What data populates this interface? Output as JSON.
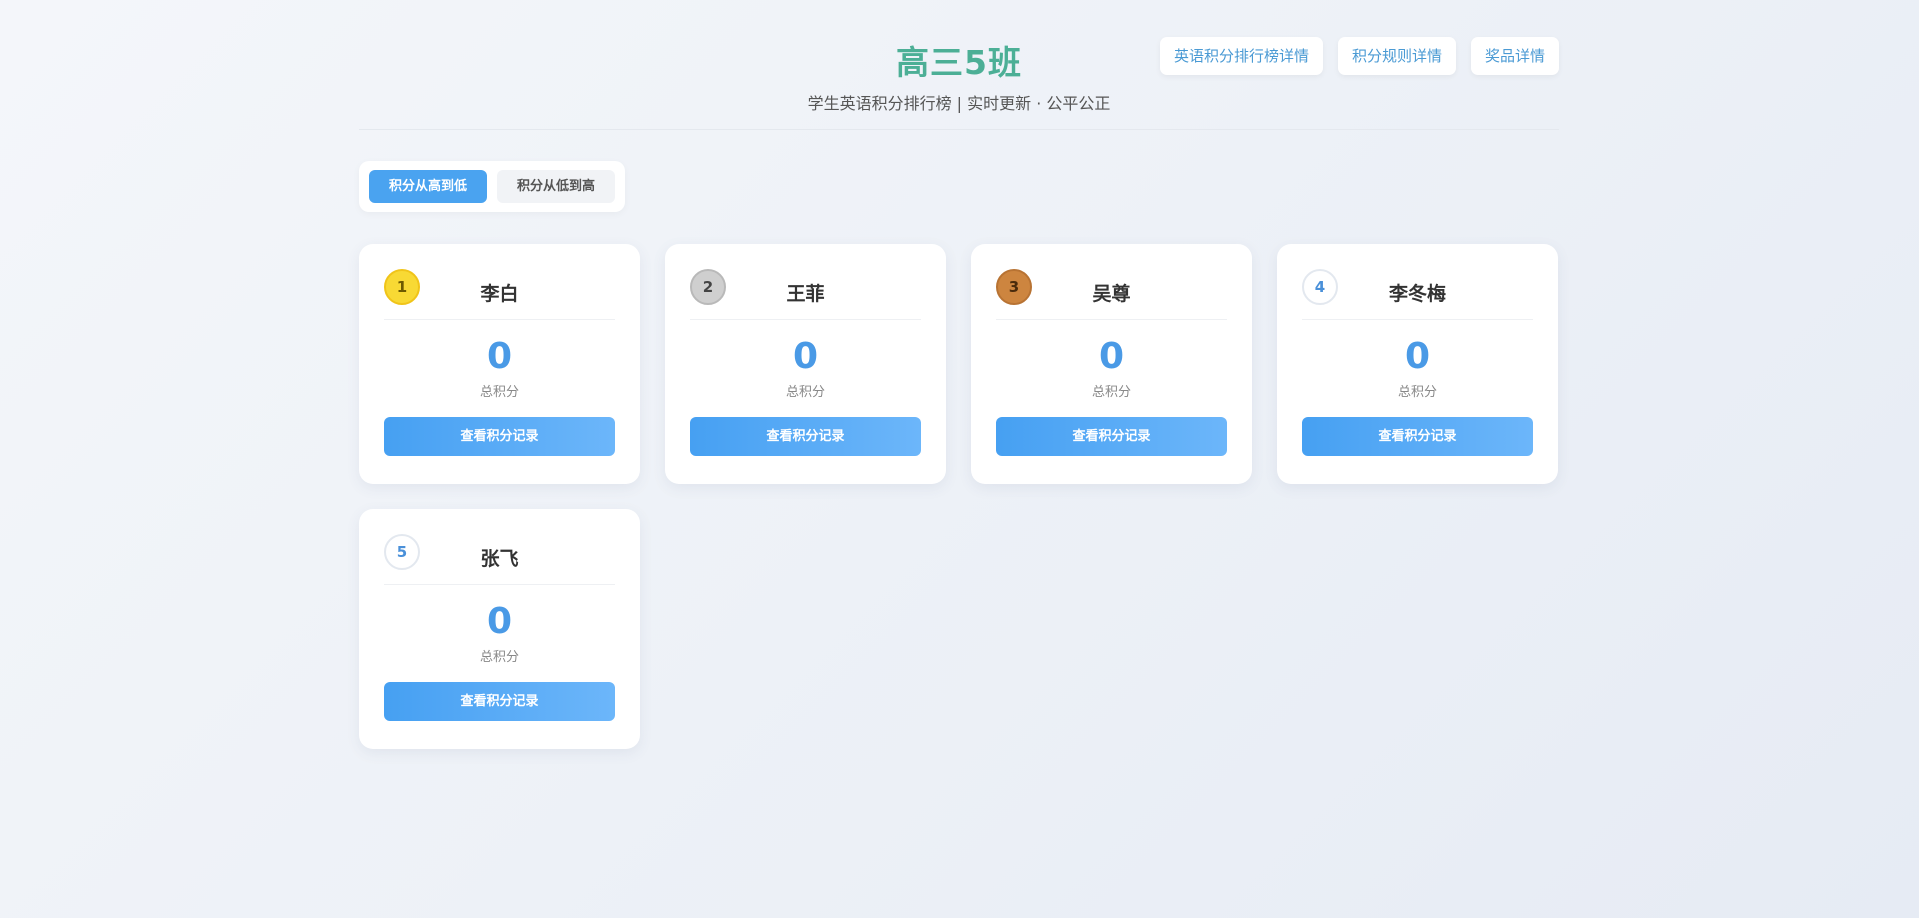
{
  "header": {
    "title": "高三5班",
    "subtitle": "学生英语积分排行榜 | 实时更新 · 公平公正",
    "nav_links": [
      "英语积分排行榜详情",
      "积分规则详情",
      "奖品详情"
    ]
  },
  "sort": {
    "options": [
      "积分从高到低",
      "积分从低到高"
    ],
    "active": "积分从高到低"
  },
  "students": [
    {
      "rank": "1",
      "name": "李白",
      "score": "0",
      "score_label": "总积分",
      "button": "查看积分记录"
    },
    {
      "rank": "2",
      "name": "王菲",
      "score": "0",
      "score_label": "总积分",
      "button": "查看积分记录"
    },
    {
      "rank": "3",
      "name": "吴尊",
      "score": "0",
      "score_label": "总积分",
      "button": "查看积分记录"
    },
    {
      "rank": "4",
      "name": "李冬梅",
      "score": "0",
      "score_label": "总积分",
      "button": "查看积分记录"
    },
    {
      "rank": "5",
      "name": "张飞",
      "score": "0",
      "score_label": "总积分",
      "button": "查看积分记录"
    }
  ],
  "colors": {
    "title": "#4caf96",
    "accent": "#4aa3f0",
    "gold": "#f8d934",
    "silver": "#cfcfcf",
    "bronze": "#cd853f"
  }
}
